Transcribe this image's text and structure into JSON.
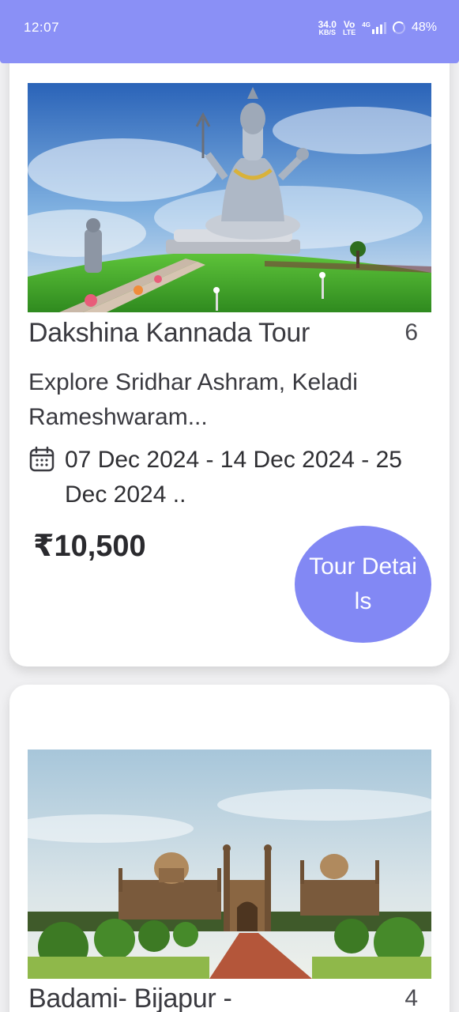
{
  "status_bar": {
    "time": "12:07",
    "net_speed": "34.0",
    "net_unit": "KB/S",
    "volte_top": "Vo",
    "volte_bottom": "LTE",
    "network": "4G",
    "battery": "48%"
  },
  "tours": [
    {
      "title": "Dakshina Kannada Tour",
      "days": "6",
      "description": "Explore Sridhar Ashram, Keladi Rameshwaram...",
      "dates": "07 Dec 2024 - 14 Dec 2024 - 25 Dec 2024 ..",
      "price": "₹10,500",
      "button_label": "Tour Details",
      "image": "shiva-statue-photo"
    },
    {
      "title": "Badami- Bijapur -",
      "days": "4",
      "image": "gol-gumbaz-monument-photo"
    }
  ],
  "colors": {
    "accent": "#8a90f6",
    "button": "#8288f4",
    "card_bg": "#ffffff",
    "page_bg": "#f0f0f2"
  }
}
